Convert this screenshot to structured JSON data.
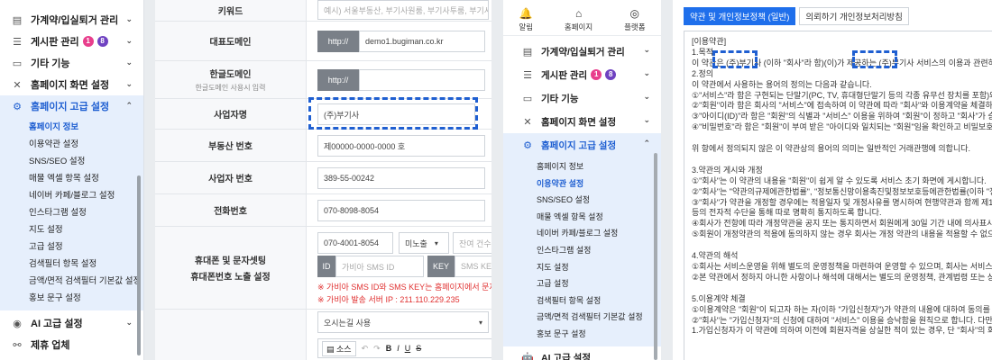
{
  "left_menu": {
    "items_top": [
      {
        "label": "가계약/입실퇴거 관리",
        "icon": "document-icon",
        "has_chevron": true
      },
      {
        "label": "게시판 관리",
        "icon": "list-icon",
        "badges": [
          "1",
          "8"
        ],
        "has_chevron": true
      },
      {
        "label": "기타 기능",
        "icon": "ad-icon",
        "has_chevron": true
      },
      {
        "label": "홈페이지 화면 설정",
        "icon": "tools-icon",
        "has_chevron": true
      },
      {
        "label": "홈페이지 고급 설정",
        "icon": "gear-icon",
        "has_chevron": true,
        "active": true
      }
    ],
    "sub_items": [
      "홈페이지 정보",
      "이용약관 설정",
      "SNS/SEO 설정",
      "매물 엑셀 항목 설정",
      "네이버 카페/블로그 설정",
      "인스타그램 설정",
      "지도 설정",
      "고급 설정",
      "검색필터 항목 설정",
      "금액/면적 검색필터 기본값 설정",
      "홍보 문구 설정"
    ],
    "selected_sub": 0,
    "items_bottom": [
      {
        "label": "AI 고급 설정",
        "icon": "robot-icon",
        "has_chevron": true
      },
      {
        "label": "제휴 업체",
        "icon": "handshake-icon",
        "has_chevron": false
      }
    ]
  },
  "form": {
    "keyword": {
      "label": "키워드",
      "placeholder": "예시) 서울부동산, 부기사원룸, 부기사투룸, 부기사부동"
    },
    "domain": {
      "label": "대표도메인",
      "prefix": "http://",
      "value": "demo1.bugiman.co.kr"
    },
    "kr_domain": {
      "label": "한글도메인",
      "sub": "한글도메인 사용시 입력",
      "prefix": "http://"
    },
    "company": {
      "label": "사업자명",
      "value": "(주)부기사"
    },
    "estate_no": {
      "label": "부동산 번호",
      "value": "제00000-0000-0000 호"
    },
    "biz_no": {
      "label": "사업자 번호",
      "value": "389-55-00242"
    },
    "phone": {
      "label": "전화번호",
      "value": "070-8098-8054"
    },
    "mobile": {
      "label1": "휴대폰 및 문자셋팅",
      "label2": "휴대폰번호 노출 설정",
      "value": "070-4001-8054",
      "select": "미노출",
      "remain_ph": "잔여 건수",
      "id_tag": "ID",
      "id_ph": "가비아 SMS ID",
      "key_tag": "KEY",
      "key_ph": "SMS KEY",
      "note1": "※ 가비아 SMS ID와 SMS KEY는 홈페이지에서 문자기능을",
      "note2": "※ 가비아 발송 서버 IP : 211.110.229.235"
    },
    "select_bottom": "오시는길 사용",
    "editor": {
      "source_label": "소스",
      "tools": [
        "↶",
        "↷",
        "B",
        "I",
        "U"
      ]
    }
  },
  "mobile_menu": {
    "top_icons": [
      {
        "label": "알림",
        "icon": "bell-icon"
      },
      {
        "label": "홈페이지",
        "icon": "home-icon"
      },
      {
        "label": "플랫폼",
        "icon": "platform-icon"
      }
    ],
    "items": [
      {
        "label": "가계약/입실퇴거 관리",
        "icon": "document-icon"
      },
      {
        "label": "게시판 관리",
        "icon": "list-icon",
        "badges": [
          "1",
          "8"
        ]
      },
      {
        "label": "기타 기능",
        "icon": "ad-icon"
      },
      {
        "label": "홈페이지 화면 설정",
        "icon": "tools-icon"
      },
      {
        "label": "홈페이지 고급 설정",
        "icon": "gear-icon",
        "active": true
      }
    ],
    "sub_items": [
      "홈페이지 정보",
      "이용약관 설정",
      "SNS/SEO 설정",
      "매물 엑셀 항목 설정",
      "네이버 카페/블로그 설정",
      "인스타그램 설정",
      "지도 설정",
      "고급 설정",
      "검색필터 항목 설정",
      "금액/면적 검색필터 기본값 설정",
      "홍보 문구 설정"
    ],
    "selected_sub": 1,
    "cut_item": "AI 고급 설정"
  },
  "terms": {
    "tab_active": "약관 및 개인정보정책 (일반)",
    "tab_inactive": "의뢰하기 개인정보처리방침",
    "lines": [
      "[이용약관]",
      "1.목적",
      "이 약관은 (주)부기사 (이하 \"회사\"라 함)(이)가 제공하는 (주)부기사 서비스의 이용과 관련하여 회사와 회원",
      "2.정의",
      "이 약관에서 사용하는 용어의 정의는 다음과 같습니다.",
      "①\"서비스\"라 함은 구현되는 단말기(PC, TV, 휴대형단말기 등의 각종 유무선 장치를 포함)와 상관없이 \"회원\"",
      "②\"회원\"이라 함은 회사의 \"서비스\"에 접속하여 이 약관에 따라 \"회사\"와 이용계약을 체결하고 \"회사\"가",
      "③\"아이디(ID)\"라 함은 \"회원\"의 식별과 \"서비스\" 이용을 위하여 \"회원\"이 정하고 \"회사\"가 승인하는 문자",
      "④\"비밀번호\"라 함은 \"회원\"이 부여 받은 \"아이디와 일치되는 \"회원\"임을 확인하고 비밀보호를 위해 \"회원\"",
      "",
      "위 항에서 정의되지 않은 이 약관상의 용어의 의미는 일반적인 거래관행에 의합니다.",
      "",
      "3.약관의 게시와 개정",
      "①\"회사\"는 이 약관의 내용을 \"회원\"이 쉽게 알 수 있도록 서비스 초기 화면에 게시합니다.",
      "②\"회사\"는 \"약관의규제에관한법률\", \"정보통신망이용촉진및정보보호등에관한법률(이하 \"정보통신망법\")\"",
      "③\"회사\"가 약관을 개정할 경우에는 적용일자 및 개정사유를 명시하여 현행약관과 함께 제1항의 방식에 따라",
      "등의 전자적 수단을 통해 따로 명확히 통지하도록 합니다.",
      "④회사가 전항에 따라 개정약관을 공지 또는 통지하면서 회원에게 30일 기간 내에 의사표시를 하지 않으면",
      "⑤회원이 개정약관의 적용에 동의하지 않는 경우 회사는 개정 약관의 내용을 적용할 수 없으며, 이 경우 회원",
      "",
      "4.약관의 해석",
      "①회사는 서비스운영을 위해 별도의 운영정책을 마련하여 운영할 수 있으며, 회사는 서비스에 운영정책",
      "②본 약관에서 정하지 아니한 사항이나 해석에 대해서는 별도의 운영정책, 관계법령 또는 상관례에 따릅니다",
      "",
      "5.이용계약 체결",
      "①이용계약은 \"회원\"이 되고자 하는 자(이하 \"가입신청자\")가 약관의 내용에 대하여 동의를 한 다음 회원",
      "②\"회사\"는 \"가입신청자\"의 신청에 대하여 \"서비스\" 이용을 승낙함을 원칙으로 합니다. 다만, \"회사\"는",
      "1.가입신청자가 이 약관에 의하여 이전에 회원자격을 상실한 적이 있는 경우, 단 \"회사\"의 회원 재가입 승"
    ]
  }
}
